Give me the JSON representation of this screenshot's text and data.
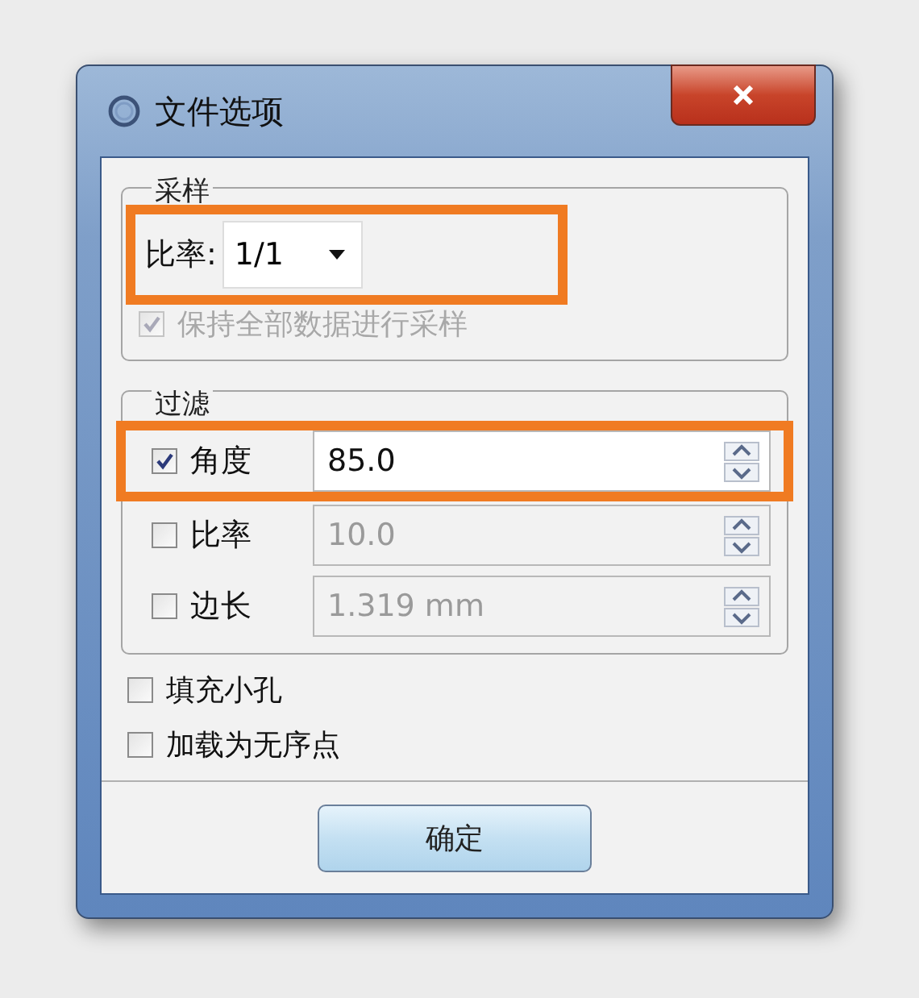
{
  "window": {
    "title": "文件选项"
  },
  "sampling": {
    "title": "采样",
    "ratio": {
      "label": "比率:",
      "value": "1/1",
      "highlighted": true
    },
    "keep_all": {
      "label": "保持全部数据进行采样",
      "checked": true,
      "disabled": true
    }
  },
  "filter": {
    "title": "过滤",
    "rows": [
      {
        "label": "角度",
        "checked": true,
        "disabled": false,
        "value": "85.0",
        "highlighted": true
      },
      {
        "label": "比率",
        "checked": false,
        "disabled": true,
        "value": "10.0",
        "highlighted": false
      },
      {
        "label": "边长",
        "checked": false,
        "disabled": true,
        "value": "1.319 mm",
        "highlighted": false
      }
    ]
  },
  "options": [
    {
      "label": "填充小孔",
      "checked": false
    },
    {
      "label": "加载为无序点",
      "checked": false
    }
  ],
  "buttons": [
    "确定"
  ]
}
